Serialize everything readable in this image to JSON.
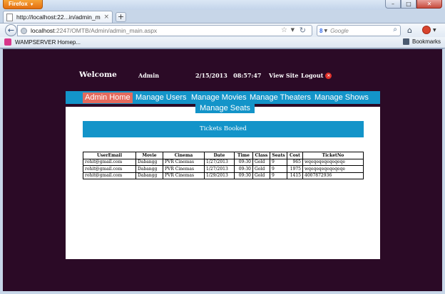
{
  "browser": {
    "menu_label": "Firefox",
    "tab_title": "http://localhost:22...in/admin_main.aspx",
    "url_host": "localhost",
    "url_path": ":2247/OMTB/Admin/admin_main.aspx",
    "search_engine": "Google",
    "bookmark_item": "WAMPSERVER Homep...",
    "bookmarks_label": "Bookmarks"
  },
  "header": {
    "welcome": "Welcome",
    "user": "Admin",
    "datetime": "2/15/2013   08:57:47",
    "view_site": "View Site",
    "logout": "Logout"
  },
  "nav": {
    "items": [
      "Admin Home",
      "Manage Users",
      "Manage Movies",
      "Manage Theaters",
      "Manage Shows"
    ],
    "second_row": "Manage Seats",
    "active": "Admin Home"
  },
  "main": {
    "banner": "Tickets Booked",
    "columns": [
      "UserEmail",
      "Movie",
      "Cinema",
      "Date",
      "Time",
      "Class",
      "Seats",
      "Cost",
      "TicketNo"
    ],
    "rows": [
      [
        "rohit@gmail.com",
        "Dabangg",
        "PVR Cinemas",
        "1/27/2013",
        "09:30",
        "Gold",
        "9",
        "965",
        "wqeqeqeqeqeqeqe"
      ],
      [
        "rohit@gmail.com",
        "Dabangg",
        "PVR Cinemas",
        "1/27/2013",
        "09:30",
        "Gold",
        "9",
        "1975",
        "wqeqeqeqeqeqeqe"
      ],
      [
        "rohit@gmail.com",
        "Dabangg",
        "PVR Cinemas",
        "1/29/2013",
        "09:30",
        "Gold",
        "9",
        "1415",
        "4007872936"
      ]
    ]
  },
  "colors": {
    "page_bg": "#2b0a26",
    "nav_bg": "#1394c9",
    "nav_active": "#e46a5d",
    "content_bg": "#ffffff"
  }
}
